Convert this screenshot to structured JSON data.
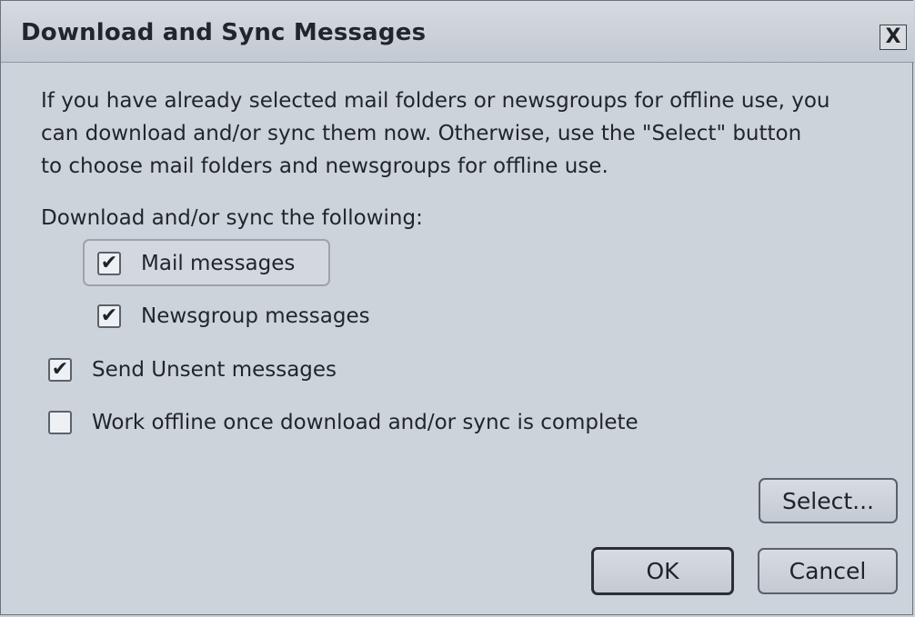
{
  "dialog": {
    "title": "Download and Sync Messages",
    "close_label": "X"
  },
  "intro": {
    "line1": "If you have already selected mail folders or newsgroups for offline use, you",
    "line2": "can download and/or sync them now. Otherwise, use the \"Select\" button",
    "line3": "to choose mail folders and newsgroups for offline use."
  },
  "section_label": "Download and/or sync the following:",
  "options": {
    "mail": {
      "label": "Mail messages",
      "checked": true
    },
    "news": {
      "label": "Newsgroup messages",
      "checked": true
    },
    "unsent": {
      "label": "Send Unsent messages",
      "checked": true
    },
    "offline": {
      "label": "Work offline once download and/or sync is complete",
      "checked": false
    }
  },
  "checkmark_glyph": "✔",
  "buttons": {
    "select": "Select...",
    "ok": "OK",
    "cancel": "Cancel"
  }
}
